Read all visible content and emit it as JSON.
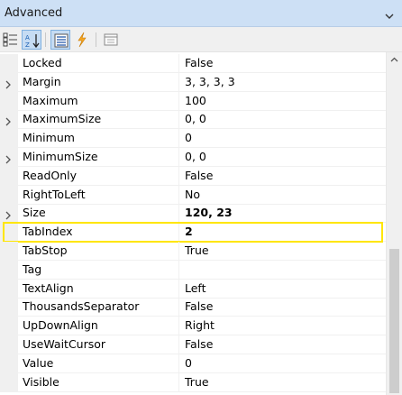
{
  "window": {
    "title": "Advanced"
  },
  "toolbar": {
    "buttons": [
      {
        "name": "categorized",
        "icon": "categorized-icon",
        "active": false
      },
      {
        "name": "alphabetical",
        "icon": "sort-alphabetical-icon",
        "active": true
      },
      {
        "name": "properties",
        "icon": "properties-icon",
        "active": true
      },
      {
        "name": "events",
        "icon": "lightning-icon",
        "active": false
      },
      {
        "name": "property-pages",
        "icon": "property-pages-icon",
        "active": false
      }
    ]
  },
  "properties": [
    {
      "name": "Locked",
      "value": "False",
      "expandable": false,
      "bold": false
    },
    {
      "name": "Margin",
      "value": "3, 3, 3, 3",
      "expandable": true,
      "bold": false
    },
    {
      "name": "Maximum",
      "value": "100",
      "expandable": false,
      "bold": false
    },
    {
      "name": "MaximumSize",
      "value": "0, 0",
      "expandable": true,
      "bold": false
    },
    {
      "name": "Minimum",
      "value": "0",
      "expandable": false,
      "bold": false
    },
    {
      "name": "MinimumSize",
      "value": "0, 0",
      "expandable": true,
      "bold": false
    },
    {
      "name": "ReadOnly",
      "value": "False",
      "expandable": false,
      "bold": false
    },
    {
      "name": "RightToLeft",
      "value": "No",
      "expandable": false,
      "bold": false
    },
    {
      "name": "Size",
      "value": "120, 23",
      "expandable": true,
      "bold": true
    },
    {
      "name": "TabIndex",
      "value": "2",
      "expandable": false,
      "bold": true,
      "highlighted": true
    },
    {
      "name": "TabStop",
      "value": "True",
      "expandable": false,
      "bold": false
    },
    {
      "name": "Tag",
      "value": "",
      "expandable": false,
      "bold": false
    },
    {
      "name": "TextAlign",
      "value": "Left",
      "expandable": false,
      "bold": false
    },
    {
      "name": "ThousandsSeparator",
      "value": "False",
      "expandable": false,
      "bold": false
    },
    {
      "name": "UpDownAlign",
      "value": "Right",
      "expandable": false,
      "bold": false
    },
    {
      "name": "UseWaitCursor",
      "value": "False",
      "expandable": false,
      "bold": false
    },
    {
      "name": "Value",
      "value": "0",
      "expandable": false,
      "bold": false
    },
    {
      "name": "Visible",
      "value": "True",
      "expandable": false,
      "bold": false
    }
  ],
  "colors": {
    "titlebar": "#cde0f5",
    "highlight_border": "#ffe600",
    "gutter": "#f0f0f0",
    "scroll_thumb": "#cdcdcd"
  }
}
